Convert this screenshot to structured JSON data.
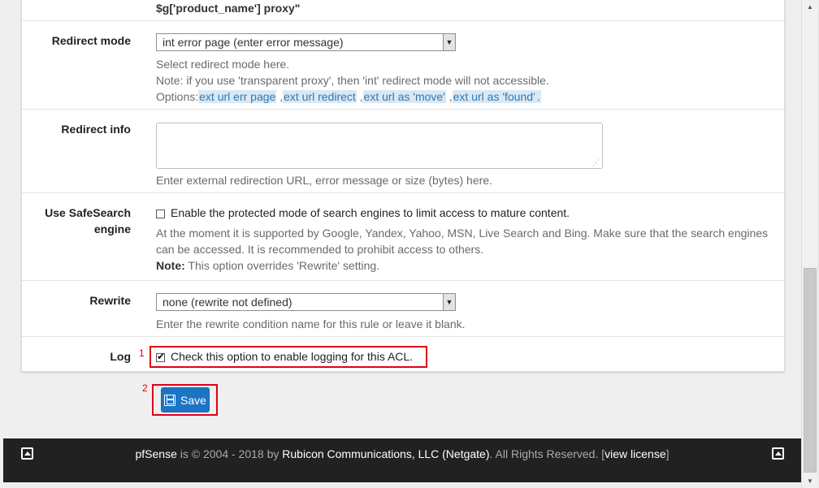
{
  "top": {
    "fragment": "$g['product_name'] proxy\""
  },
  "redirect_mode": {
    "label": "Redirect mode",
    "selected": "int error page (enter error message)",
    "help1": "Select redirect mode here.",
    "help2": "Note: if you use 'transparent proxy', then 'int' redirect mode will not accessible.",
    "options_prefix": "Options:",
    "links": [
      "ext url err page",
      "ext url redirect",
      "ext url as 'move'",
      "ext url as 'found'"
    ],
    "sep": ",",
    "end": "."
  },
  "redirect_info": {
    "label": "Redirect info",
    "value": "",
    "help": "Enter external redirection URL, error message or size (bytes) here."
  },
  "safesearch": {
    "label_line1": "Use SafeSearch",
    "label_line2": "engine",
    "checkbox_label": "Enable the protected mode of search engines to limit access to mature content.",
    "checked": false,
    "help1": "At the moment it is supported by Google, Yandex, Yahoo, MSN, Live Search and Bing. Make sure that the search engines",
    "help2": "can be accessed. It is recommended to prohibit access to others.",
    "note_label": "Note:",
    "note_text": "This option overrides 'Rewrite' setting."
  },
  "rewrite": {
    "label": "Rewrite",
    "selected": "none (rewrite not defined)",
    "help": "Enter the rewrite condition name for this rule or leave it blank."
  },
  "log": {
    "label": "Log",
    "checkbox_label": "Check this option to enable logging for this ACL.",
    "checked": true,
    "marker": "1"
  },
  "save": {
    "label": "Save",
    "marker": "2"
  },
  "footer": {
    "product": "pfSense",
    "is": "is",
    "copyright": "© 2004 - 2018 by",
    "company": "Rubicon Communications, LLC (Netgate)",
    "rights": ". All Rights Reserved. [",
    "license_link": "view license",
    "close": "]"
  },
  "colors": {
    "accent": "#1e74c4",
    "highlight": "#e0001b",
    "link": "#2e79b5",
    "footer_bg": "#212121"
  }
}
